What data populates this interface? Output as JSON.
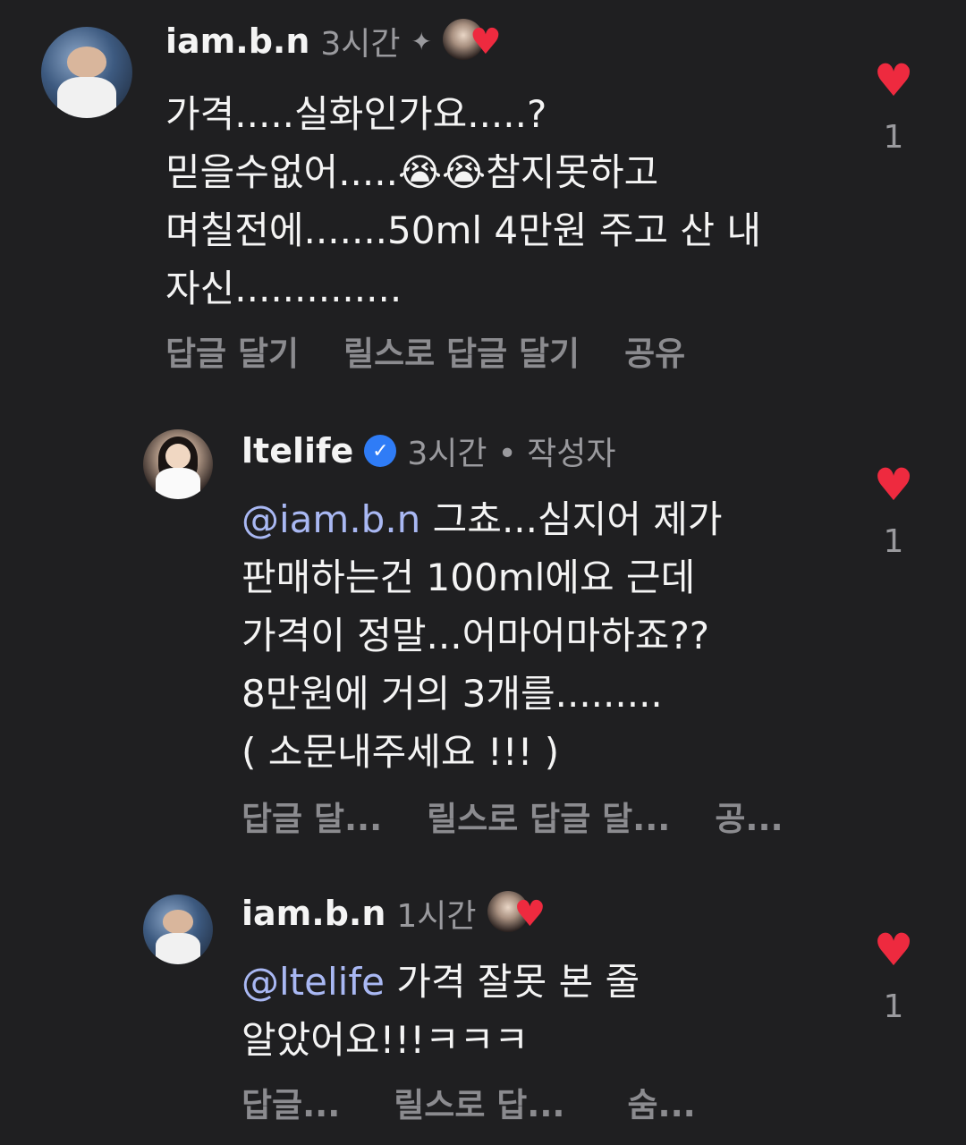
{
  "comments": [
    {
      "username": "iam.b.n",
      "time": "3시간",
      "pinned": true,
      "text": "가격.....실화인가요.....?\n믿을수없어.....😭😭참지못하고\n며칠전에.......50ml 4만원 주고 산 내\n자신..............",
      "mention": "",
      "actions": [
        "답글 달기",
        "릴스로 답글 달기",
        "공유"
      ],
      "likes": "1"
    },
    {
      "username": "ltelife",
      "time": "3시간",
      "author_label": "• 작성자",
      "mention": "@iam.b.n",
      "text": " 그쵸...심지어 제가\n판매하는건 100ml에요 근데\n가격이 정말...어마어마하죠??\n8만원에 거의 3개를.........\n( 소문내주세요 !!! )",
      "actions": [
        "답글 달...",
        "릴스로 답글 달...",
        "공..."
      ],
      "likes": "1"
    },
    {
      "username": "iam.b.n",
      "time": "1시간",
      "mention": "@ltelife",
      "text": " 가격 잘못 본 줄\n알았어요!!!ㅋㅋㅋ",
      "actions": [
        "답글...",
        "릴스로 답...",
        "숨..."
      ],
      "likes": "1"
    }
  ],
  "icons": {
    "heart": "heart-icon",
    "pin": "pin-icon",
    "verified": "verified-icon"
  },
  "colors": {
    "background": "#1f1f21",
    "heart": "#ee2a3f",
    "mention": "#a9b8f3",
    "verified": "#2f7cf6"
  }
}
